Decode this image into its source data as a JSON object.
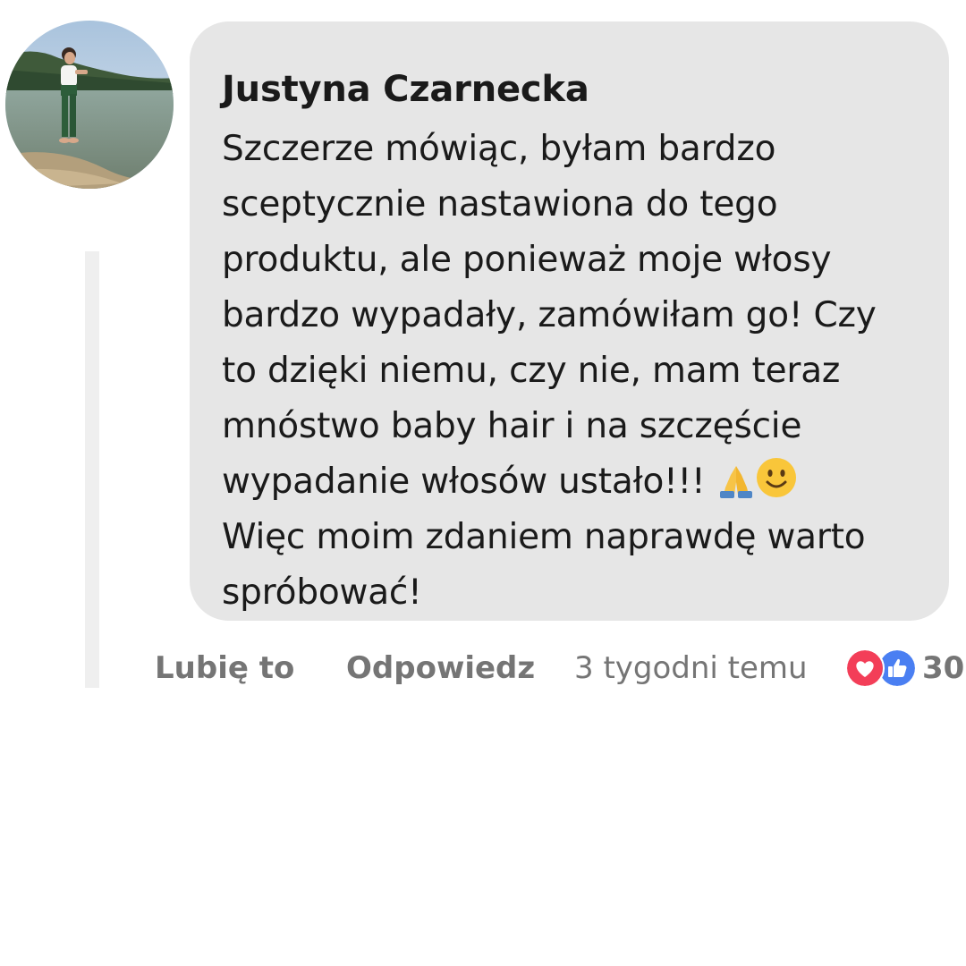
{
  "comment": {
    "author": "Justyna Czarnecka",
    "text_lines": [
      "Szczerze mówiąc, byłam bardzo",
      "sceptycznie nastawiona do tego",
      "produktu, ale ponieważ moje włosy",
      "bardzo wypadały, zamówiłam go! Czy",
      "to dzięki niemu, czy nie, mam teraz",
      "mnóstwo baby hair i na szczęście",
      "wypadanie włosów ustało!!!",
      "Więc moim zdaniem naprawdę warto",
      "spróbować!"
    ],
    "emojis": [
      "folded-hands-icon",
      "slightly-smiling-face-icon"
    ]
  },
  "actions": {
    "like_label": "Lubię to",
    "reply_label": "Odpowiedz",
    "timestamp": "3 tygodni temu"
  },
  "reactions": {
    "icons": [
      "heart-icon",
      "thumbs-up-icon"
    ],
    "count": "30"
  },
  "colors": {
    "bubble_background": "#e6e6e6",
    "action_text": "#757575",
    "heart": "#f33e58",
    "like": "#1877f2"
  }
}
